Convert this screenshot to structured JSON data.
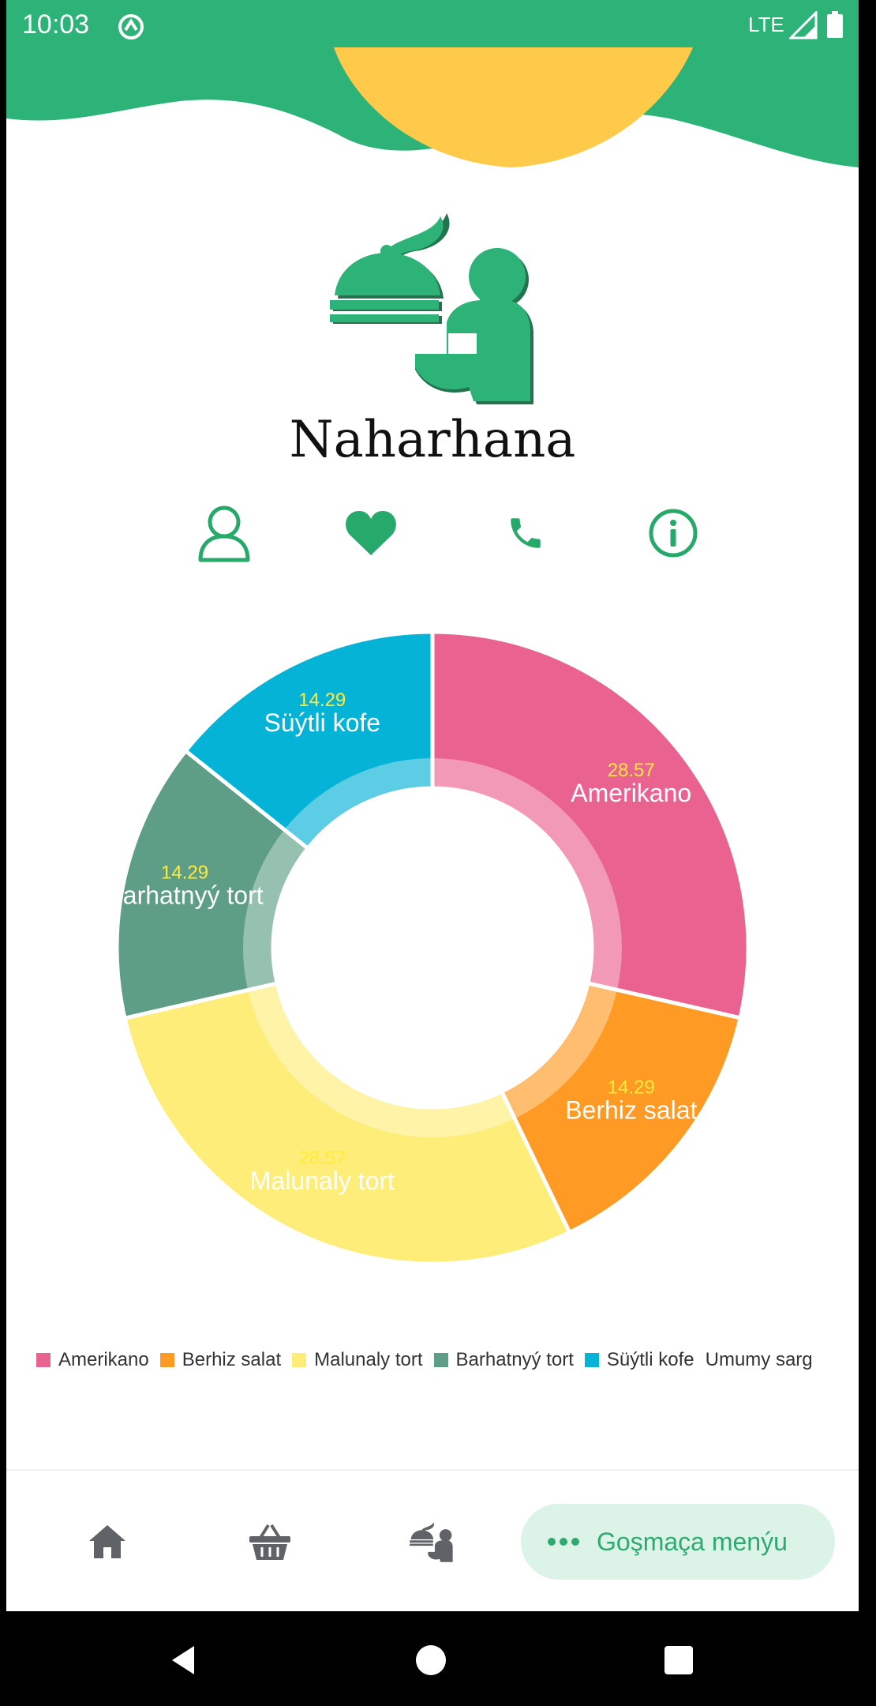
{
  "status_bar": {
    "time": "10:03",
    "network": "LTE",
    "icons": [
      "sync-icon",
      "signal-icon",
      "battery-icon"
    ]
  },
  "header": {
    "app_title": "Naharhana",
    "logo_icon": "waiter-serving-icon",
    "actions": [
      {
        "name": "profile",
        "icon": "person-outline-icon"
      },
      {
        "name": "favorites",
        "icon": "heart-icon"
      },
      {
        "name": "call",
        "icon": "phone-icon"
      },
      {
        "name": "info",
        "icon": "info-icon"
      }
    ]
  },
  "colors": {
    "brand_green": "#2DB378",
    "accent_yellow": "#FFC94A",
    "icon_green": "#28A96C",
    "nav_pill_bg": "#DCF3E8",
    "nav_gray": "#5F6368"
  },
  "chart_data": {
    "type": "pie",
    "donut": true,
    "slices": [
      {
        "label": "Amerikano",
        "value": 28.57,
        "value_text": "28.57",
        "color": "#EA6390"
      },
      {
        "label": "Berhiz salat",
        "value": 14.29,
        "value_text": "14.29",
        "color": "#FF9A24"
      },
      {
        "label": "Malunaly tort",
        "value": 28.57,
        "value_text": "28.57",
        "color": "#FFED7A"
      },
      {
        "label": "Barhatnyý tort",
        "value": 14.29,
        "value_text": "14.29",
        "color": "#5E9E86"
      },
      {
        "label": "Süýtli kofe",
        "value": 14.29,
        "value_text": "14.29",
        "color": "#05B3D6"
      }
    ],
    "legend": {
      "placement": "bottom",
      "entries": [
        "Amerikano",
        "Berhiz salat",
        "Malunaly tort",
        "Barhatnyý tort",
        "Süýtli kofe"
      ],
      "trailing_text": "Umumy sarg"
    }
  },
  "bottom_nav": {
    "items": [
      {
        "name": "home",
        "icon": "home-icon"
      },
      {
        "name": "basket",
        "icon": "basket-icon"
      },
      {
        "name": "waiter",
        "icon": "waiter-icon"
      }
    ],
    "more_label": "Goşmaça menýu",
    "more_icon": "more-dots-icon"
  },
  "system_nav": {
    "buttons": [
      "back-icon",
      "home-circle-icon",
      "recents-icon"
    ]
  }
}
